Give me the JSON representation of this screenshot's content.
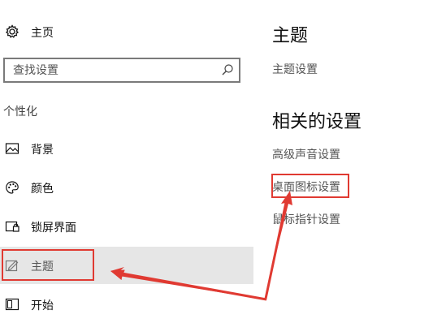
{
  "sidebar": {
    "home_label": "主页",
    "search_placeholder": "查找设置",
    "section_label": "个性化",
    "items": [
      {
        "label": "背景",
        "icon": "image-icon"
      },
      {
        "label": "颜色",
        "icon": "palette-icon"
      },
      {
        "label": "锁屏界面",
        "icon": "lock-screen-icon"
      },
      {
        "label": "主题",
        "icon": "theme-icon"
      },
      {
        "label": "开始",
        "icon": "start-icon"
      }
    ],
    "selected_index": 3
  },
  "main": {
    "title": "主题",
    "theme_settings_link": "主题设置",
    "related_title": "相关的设置",
    "links": [
      "高级声音设置",
      "桌面图标设置",
      "鼠标指针设置"
    ]
  },
  "colors": {
    "annotation_red": "#e03a32",
    "selected_bg": "#e6e6e6"
  }
}
